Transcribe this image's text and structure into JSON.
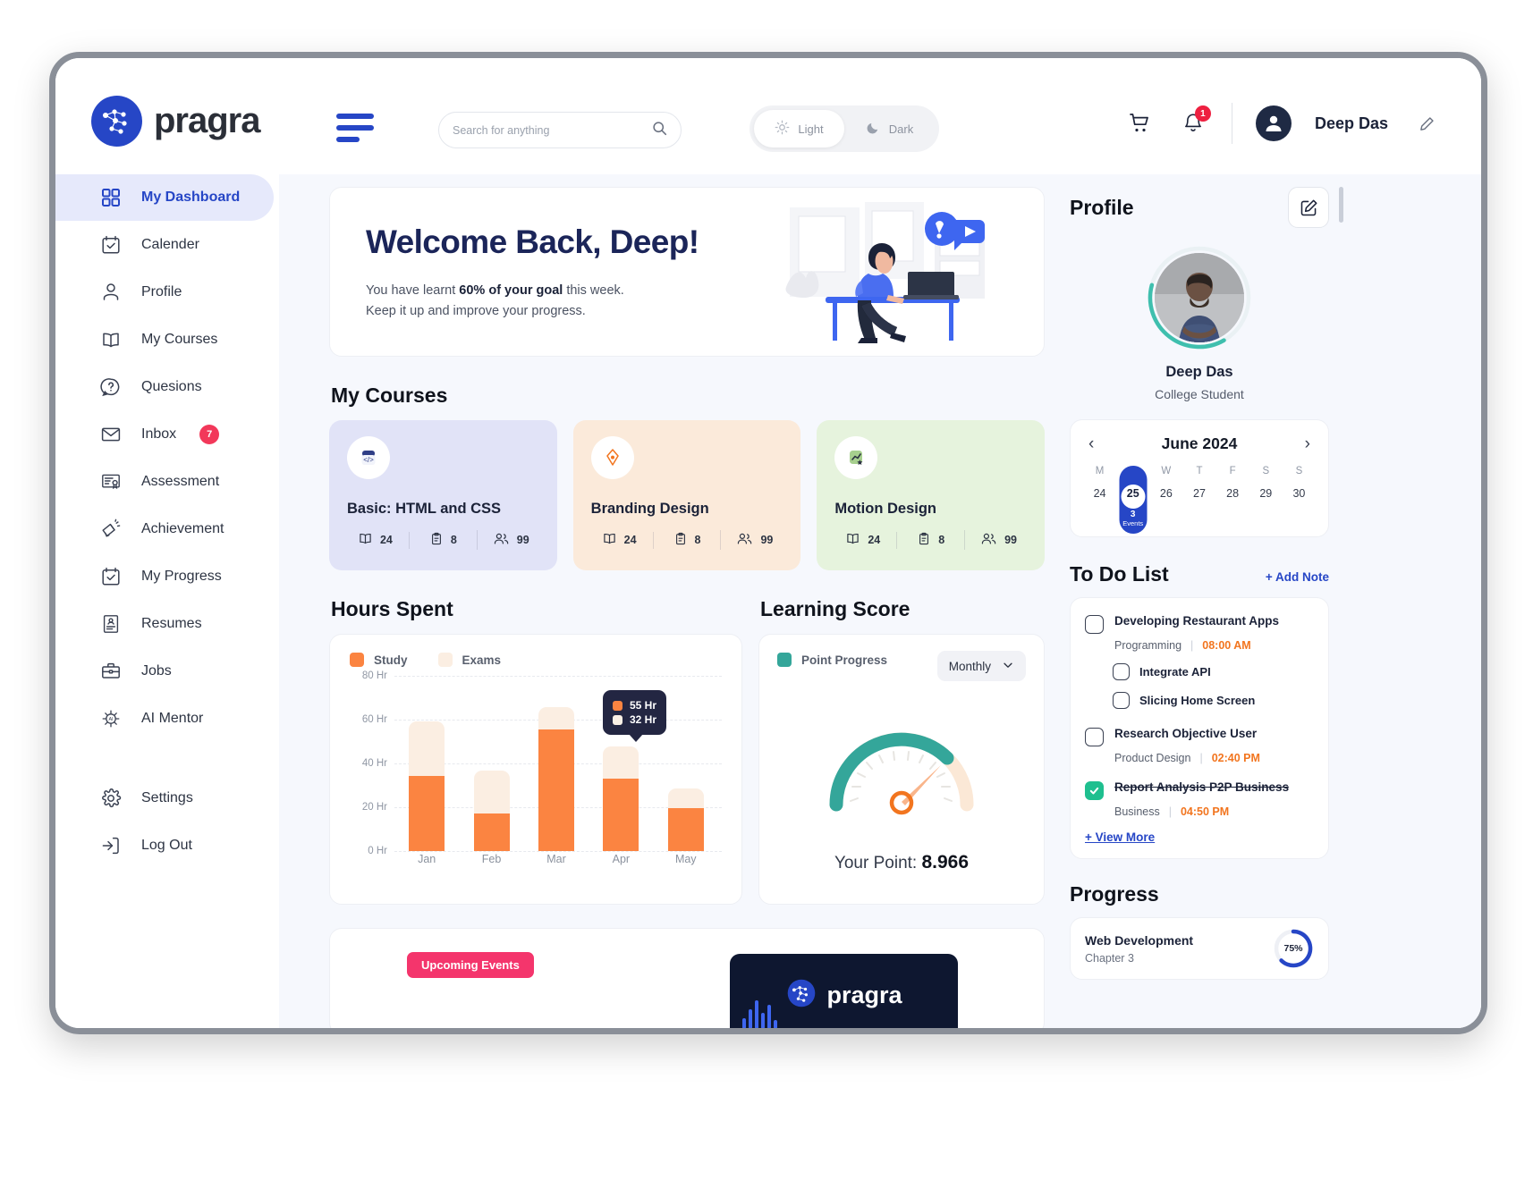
{
  "brand": {
    "name": "pragra",
    "logo_icon": "network-nodes-icon",
    "accent": "#2646c6"
  },
  "header": {
    "menu_icon": "hamburger-icon",
    "search": {
      "placeholder": "Search for anything",
      "value": "",
      "icon": "search-icon"
    },
    "theme": {
      "light_label": "Light",
      "dark_label": "Dark",
      "light_icon": "sun-icon",
      "dark_icon": "moon-icon",
      "active": "Light"
    },
    "cart_icon": "shopping-cart-icon",
    "bell_icon": "bell-icon",
    "notification_count": "1",
    "avatar_icon": "user-avatar-icon",
    "user_name": "Deep Das",
    "edit_icon": "pencil-icon"
  },
  "sidebar": {
    "items": [
      {
        "label": "My Dashboard",
        "icon": "grid-icon",
        "active": true
      },
      {
        "label": "Calender",
        "icon": "calendar-check-icon",
        "active": false
      },
      {
        "label": "Profile",
        "icon": "person-icon",
        "active": false
      },
      {
        "label": "My Courses",
        "icon": "open-book-icon",
        "active": false
      },
      {
        "label": "Quesions",
        "icon": "question-bubble-icon",
        "active": false
      },
      {
        "label": "Inbox",
        "icon": "envelope-icon",
        "active": false,
        "badge": "7"
      },
      {
        "label": "Assessment",
        "icon": "certificate-icon",
        "active": false
      },
      {
        "label": "Achievement",
        "icon": "megaphone-icon",
        "active": false
      },
      {
        "label": "My Progress",
        "icon": "calendar-check-icon",
        "active": false
      },
      {
        "label": "Resumes",
        "icon": "resume-document-icon",
        "active": false
      },
      {
        "label": "Jobs",
        "icon": "briefcase-icon",
        "active": false
      },
      {
        "label": "AI Mentor",
        "icon": "ai-chip-icon",
        "active": false
      }
    ],
    "footer_items": [
      {
        "label": "Settings",
        "icon": "gear-icon"
      },
      {
        "label": "Log Out",
        "icon": "logout-arrow-icon"
      }
    ]
  },
  "welcome": {
    "title": "Welcome Back, Deep!",
    "line1_pre": "You have learnt ",
    "line1_bold": "60% of your goal",
    "line1_post": " this week.",
    "line2": "Keep it up and improve your progress.",
    "illustration": "student-at-desk-illustration"
  },
  "my_courses": {
    "title": "My Courses",
    "cards": [
      {
        "name": "Basic: HTML and CSS",
        "bg": "#e1e3f7",
        "icon": "code-brackets-icon",
        "icon_bg": "#2f3e86",
        "lessons": "24",
        "assignments": "8",
        "students": "99"
      },
      {
        "name": "Branding Design",
        "bg": "#fbeada",
        "icon": "pen-nib-icon",
        "icon_bg": "#f2751f",
        "lessons": "24",
        "assignments": "8",
        "students": "99"
      },
      {
        "name": "Motion Design",
        "bg": "#e6f3dd",
        "icon": "chart-star-icon",
        "icon_bg": "#8cc36f",
        "lessons": "24",
        "assignments": "8",
        "students": "99"
      }
    ],
    "stat_icons": {
      "lessons": "book-icon",
      "assignments": "clipboard-icon",
      "students": "people-icon"
    }
  },
  "hours_spent": {
    "title": "Hours Spent",
    "tooltip": {
      "study_value": "55 Hr",
      "exams_value": "32 Hr",
      "anchor_category": "Apr"
    }
  },
  "learning_score": {
    "title": "Learning Score",
    "legend_label": "Point Progress",
    "legend_color": "#34a69a",
    "period_selected": "Monthly",
    "period_icon": "chevron-down-icon",
    "your_point_label": "Your Point:",
    "your_point_value": "8.966",
    "gauge_needle_color": "#f2751f"
  },
  "banner": {
    "tag": "Upcoming Events",
    "brand_text": "pragra",
    "brand_icon": "network-nodes-icon"
  },
  "profile": {
    "title": "Profile",
    "edit_icon": "edit-square-icon",
    "name": "Deep Das",
    "role": "College Student",
    "avatar": "profile-photo",
    "ring_color": "#3fbfae"
  },
  "calendar": {
    "month": "June 2024",
    "prev_icon": "chevron-left-icon",
    "next_icon": "chevron-right-icon",
    "dow": [
      "M",
      "T",
      "W",
      "T",
      "F",
      "S",
      "S"
    ],
    "days": [
      "24",
      "25",
      "26",
      "27",
      "28",
      "29",
      "30"
    ],
    "selected": "25",
    "selected_events_count": "3",
    "selected_events_label": "Events"
  },
  "todo": {
    "title": "To Do List",
    "add_label": "+ Add Note",
    "view_more": "+ View More",
    "items": [
      {
        "title": "Developing Restaurant Apps",
        "category": "Programming",
        "time": "08:00 AM",
        "checked": false,
        "subtasks": [
          {
            "label": "Integrate API",
            "checked": false
          },
          {
            "label": "Slicing Home Screen",
            "checked": false
          }
        ]
      },
      {
        "title": "Research Objective User",
        "category": "Product Design",
        "time": "02:40 PM",
        "checked": false,
        "subtasks": []
      },
      {
        "title": "Report Analysis P2P Business",
        "category": "Business",
        "time": "04:50 PM",
        "checked": true,
        "subtasks": []
      }
    ]
  },
  "progress": {
    "title": "Progress",
    "items": [
      {
        "name": "Web Development",
        "sub": "Chapter 3",
        "percent": "75%",
        "value": 75,
        "color": "#2646c6"
      }
    ]
  },
  "chart_data": {
    "type": "bar",
    "title": "Hours Spent",
    "categories": [
      "Jan",
      "Feb",
      "Mar",
      "Apr",
      "May"
    ],
    "series": [
      {
        "name": "Study",
        "color": "#fb8441",
        "values": [
          38,
          19,
          62,
          37,
          22
        ]
      },
      {
        "name": "Exams",
        "color": "#fbeee2",
        "values": [
          28,
          22,
          11,
          16,
          10
        ]
      }
    ],
    "stacked": true,
    "totals": [
      66,
      41,
      73,
      53,
      32
    ],
    "ylabel": "",
    "xlabel": "",
    "ylim": [
      0,
      80
    ],
    "yticks": [
      0,
      20,
      40,
      60,
      80
    ],
    "ytick_labels": [
      "0 Hr",
      "20 Hr",
      "40 Hr",
      "60 Hr",
      "80 Hr"
    ],
    "grid": true,
    "legend": [
      "Study",
      "Exams"
    ],
    "legend_position": "top-left",
    "annotations": [
      {
        "category": "Apr",
        "study": "55 Hr",
        "exams": "32 Hr"
      }
    ]
  },
  "gauge_data": {
    "type": "gauge",
    "title": "Learning Score",
    "value": 8.966,
    "max": 10,
    "filled_color": "#34a69a",
    "track_color": "#fbe8d6",
    "label": "Your Point:",
    "display_value": "8.966"
  }
}
